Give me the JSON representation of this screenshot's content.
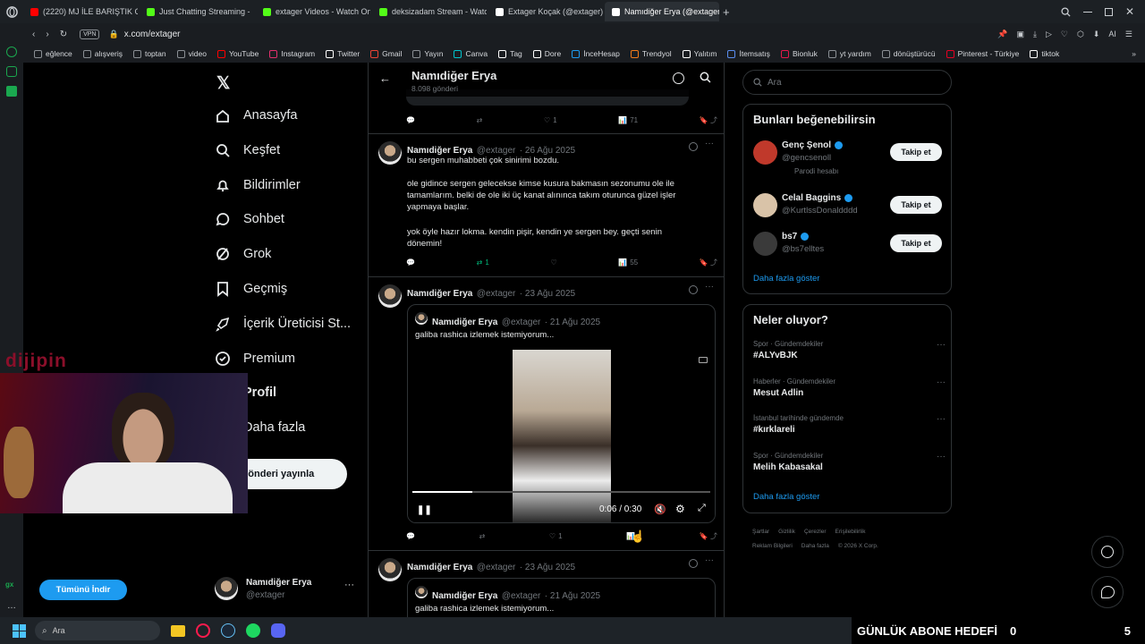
{
  "browser": {
    "tabs": [
      {
        "title": "(2220) MJ İLE BARIŞTIK G",
        "color": "#ff0000"
      },
      {
        "title": "Just Chatting Streaming -",
        "color": "#53fc18"
      },
      {
        "title": "extager Videos - Watch On",
        "color": "#53fc18"
      },
      {
        "title": "deksizadam Stream - Watc",
        "color": "#53fc18"
      },
      {
        "title": "Extager Koçak (@extager)",
        "color": "#ffffff"
      },
      {
        "title": "Namıdiğer Erya (@extager)",
        "color": "#ffffff"
      }
    ],
    "vpn_badge": "VPN",
    "url": "x.com/extager",
    "bookmarks": [
      {
        "label": "eğlence",
        "color": "#8a8f94"
      },
      {
        "label": "alışveriş",
        "color": "#8a8f94"
      },
      {
        "label": "toptan",
        "color": "#8a8f94"
      },
      {
        "label": "video",
        "color": "#8a8f94"
      },
      {
        "label": "YouTube",
        "color": "#ff0000"
      },
      {
        "label": "Instagram",
        "color": "#e1306c"
      },
      {
        "label": "Twitter",
        "color": "#ffffff"
      },
      {
        "label": "Gmail",
        "color": "#ea4335"
      },
      {
        "label": "Yayın",
        "color": "#8a8f94"
      },
      {
        "label": "Canva",
        "color": "#00c4cc"
      },
      {
        "label": "Tag",
        "color": "#ffffff"
      },
      {
        "label": "Dore",
        "color": "#ffffff"
      },
      {
        "label": "İnceHesap",
        "color": "#1d9bf0"
      },
      {
        "label": "Trendyol",
        "color": "#f27a1a"
      },
      {
        "label": "Yalıtım",
        "color": "#ffffff"
      },
      {
        "label": "İtemsatış",
        "color": "#5a8dee"
      },
      {
        "label": "Bionluk",
        "color": "#e5194b"
      },
      {
        "label": "yt yardım",
        "color": "#8a8f94"
      },
      {
        "label": "dönüştürücü",
        "color": "#8a8f94"
      },
      {
        "label": "Pinterest - Türkiye",
        "color": "#e60023"
      },
      {
        "label": "tiktok",
        "color": "#ffffff"
      }
    ],
    "ai_label": "AI"
  },
  "nav": {
    "items": [
      {
        "label": "Anasayfa",
        "icon": "home-icon"
      },
      {
        "label": "Keşfet",
        "icon": "search-icon"
      },
      {
        "label": "Bildirimler",
        "icon": "bell-icon"
      },
      {
        "label": "Sohbet",
        "icon": "chat-icon"
      },
      {
        "label": "Grok",
        "icon": "grok-icon"
      },
      {
        "label": "Geçmiş",
        "icon": "bookmark-icon"
      },
      {
        "label": "İçerik Üreticisi St...",
        "icon": "rocket-icon"
      },
      {
        "label": "Premium",
        "icon": "verified-icon"
      },
      {
        "label": "Profil",
        "icon": "profile-icon"
      },
      {
        "label": "Daha fazla",
        "icon": "more-icon"
      }
    ],
    "post_button": "Gönderi yayınla",
    "account_name": "Namıdiğer Erya",
    "account_handle": "@extager"
  },
  "profile_header": {
    "name": "Namıdiğer Erya",
    "posts": "8.098 gönderi"
  },
  "tweets": [
    {
      "name": "Namıdiğer Erya",
      "handle": "@extager",
      "date": "· 26 Ağu 2025",
      "paragraphs": [
        "bu sergen muhabbeti çok sinirimi bozdu.",
        "ole gidince sergen gelecekse kimse kusura bakmasın sezonumu ole ile tamamlarım. belki de ole iki üç kanat alınınca takım oturunca güzel işler yapmaya başlar.",
        "yok öyle hazır lokma. kendin pişir, kendin ye sergen bey. geçti senin dönemin!"
      ],
      "retweets": "1",
      "views": "55"
    },
    {
      "name": "Namıdiğer Erya",
      "handle": "@extager",
      "date": "· 23 Ağu 2025",
      "quote": {
        "name": "Namıdiğer Erya",
        "handle": "@extager",
        "date": "· 21 Ağu 2025",
        "text": "galiba rashica izlemek istemiyorum..."
      },
      "video_time": "0:06 / 0:30",
      "video_progress": 0.2,
      "likes": "1"
    },
    {
      "name": "Namıdiğer Erya",
      "handle": "@extager",
      "date": "· 23 Ağu 2025",
      "quote": {
        "name": "Namıdiğer Erya",
        "handle": "@extager",
        "date": "· 21 Ağu 2025",
        "text": "galiba rashica izlemek istemiyorum..."
      }
    }
  ],
  "prev_tweet": {
    "likes": "1",
    "views": "71"
  },
  "search": {
    "placeholder": "Ara"
  },
  "who_to_follow": {
    "title": "Bunları beğenebilirsin",
    "users": [
      {
        "name": "Genç Şenol",
        "handle": "@gencsenoll",
        "note": "Parodi hesabı"
      },
      {
        "name": "Celal Baggins",
        "handle": "@KurtlssDonaldddd",
        "note": ""
      },
      {
        "name": "bs7",
        "handle": "@bs7elltes",
        "note": ""
      }
    ],
    "follow_label": "Takip et",
    "show_more": "Daha fazla göster"
  },
  "trends": {
    "title": "Neler oluyor?",
    "items": [
      {
        "context": "Spor · Gündemdekiler",
        "title": "#ALYvBJK"
      },
      {
        "context": "Haberler · Gündemdekiler",
        "title": "Mesut Adlin"
      },
      {
        "context": "İstanbul tarihinde gündemde",
        "title": "#kırklareli"
      },
      {
        "context": "Spor · Gündemdekiler",
        "title": "Melih Kabasakal"
      }
    ],
    "show_more": "Daha fazla göster"
  },
  "footer": {
    "row1": [
      "Şartlar",
      "Gizlilik",
      "Çerezler",
      "Erişilebilirlik"
    ],
    "row2": [
      "Reklam Bilgileri",
      "Daha fazla",
      "© 2026 X Corp."
    ]
  },
  "overlay": {
    "logo": "dijipin",
    "download_button": "Tümünü İndir"
  },
  "taskbar": {
    "search_placeholder": "Ara",
    "goal_label": "GÜNLÜK ABONE HEDEFİ",
    "goal_value": "0",
    "goal_target": "5"
  }
}
